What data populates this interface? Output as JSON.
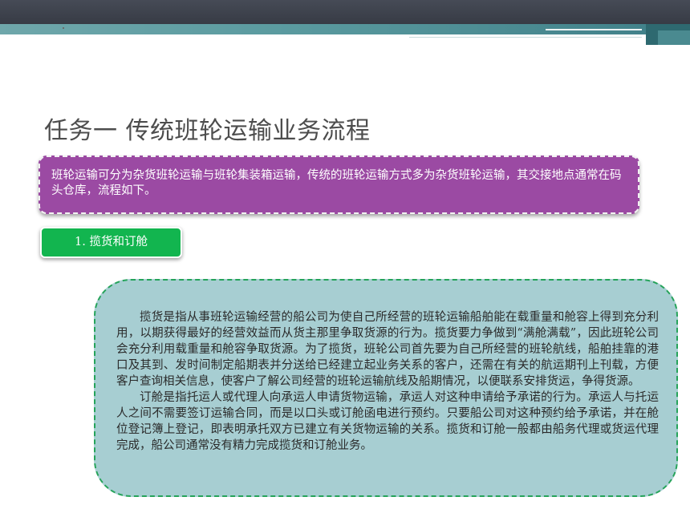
{
  "slide": {
    "title": "任务一 传统班轮运输业务流程",
    "intro": "班轮运输可分为杂货班轮运输与班轮集装箱运输，传统的班轮运输方式多为杂货班轮运输，其交接地点通常在码头仓库，流程如下。",
    "step_label": "1. 揽货和订舱",
    "paragraphs": [
      "揽货是指从事班轮运输经营的船公司为使自己所经营的班轮运输船舶能在载重量和舱容上得到充分利用，以期获得最好的经营效益而从货主那里争取货源的行为。揽货要力争做到“满舱满载”，因此班轮公司会充分利用载重量和舱容争取货源。为了揽货，班轮公司首先要为自己所经营的班轮航线，船舶挂靠的港口及其到、发时间制定船期表并分送给已经建立起业务关系的客户，还需在有关的航运期刊上刊载，方便客户查询相关信息，使客户了解公司经营的班轮运输航线及船期情况，以便联系安排货运，争得货源。",
      "订舱是指托运人或代理人向承运人申请货物运输，承运人对这种申请给予承诺的行为。承运人与托运人之间不需要签订运输合同，而是以口头或订舱函电进行预约。只要船公司对这种预约给予承诺，并在舱位登记簿上登记，即表明承托双方已建立有关货物运输的关系。揽货和订舱一般都由船务代理或货运代理完成，船公司通常没有精力完成揽货和订舱业务。"
    ]
  },
  "colors": {
    "header_dark": "#3d414b",
    "header_teal": "#5b9ba0",
    "intro_bg": "#9b4aa3",
    "step_bg": "#12b54f",
    "body_bg": "#a7ced2",
    "body_border": "#25a35a"
  }
}
